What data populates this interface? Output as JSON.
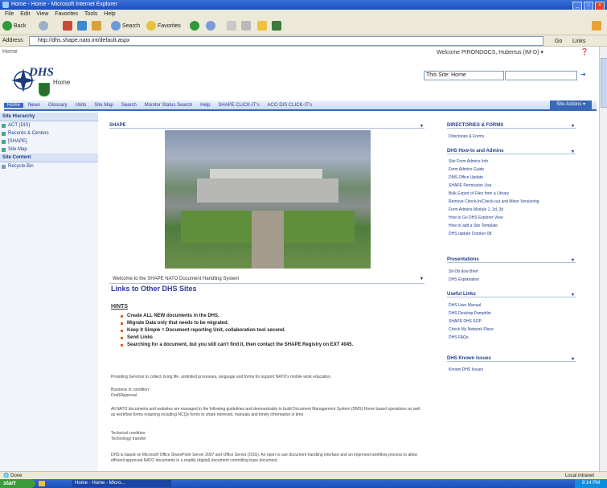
{
  "window": {
    "title": "Home - Home - Microsoft Internet Explorer"
  },
  "menu": [
    "File",
    "Edit",
    "View",
    "Favorites",
    "Tools",
    "Help"
  ],
  "toolbar": {
    "back": "Back",
    "search": "Search",
    "favorites": "Favorites"
  },
  "address": {
    "label": "Address",
    "url": "http://dhs.shape.nato.int/default.aspx",
    "go": "Go",
    "links": "Links"
  },
  "page": {
    "home_link": "Home",
    "welcome": "Welcome PIRONDOCS, Hubertus (IM-D) ▾",
    "logo_text": "DHS",
    "site_title": "Home",
    "search_scope": "This Site: Home",
    "top_nav": [
      "Home",
      "News",
      "Glossary",
      "Units",
      "Site Map",
      "Search",
      "Monitor Status Search",
      "Help",
      "SHAPE CLICK-IT's",
      "ACO DIS CLICK-IT's"
    ],
    "site_actions": "Site Actions ▾"
  },
  "quicklaunch": {
    "hierarchy_head": "Site Hierarchy",
    "items": [
      "ACT (DIS)",
      "Records & Centers",
      "[SHAPE]",
      "Site Map"
    ],
    "content_head": "Site Content",
    "recycle": "Recycle Bin"
  },
  "main": {
    "webpart_title": "SHAPE",
    "caption": "Welcome to the SHAPE NATO Document Handling System",
    "links_heading": "Links to Other DHS Sites",
    "hints_heading": "HINTS",
    "bullets": [
      "Create ALL NEW documents in the DHS.",
      "Migrate Data only that needs to be migrated.",
      "Keep It Simple = Document reporting Unit, collaboration tool second.",
      "Send Links",
      "Searching for a document, but you still can't find it, then contact the SHAPE Registry on EXT 4045."
    ],
    "para1": "Providing Services to collect, bring life, unlimited processes, language and forms for support NATO's mobile work education.",
    "para2_head": "Business in condition:",
    "para2": "Draft/Approval",
    "para3": "All NATO documents and websites are managed in the following guidelines and demonstrably to build Document Management System (DMS) Home based operations as well as workflow forms requiring including NCQs forms to share retrieved, manuals and timely information in time.",
    "para4_head": "Technical condition:",
    "para4": "Technology transfer",
    "para5": "DHS is based on Microsoft Office SharePoint Server 2007 and Office Server (OSS). An open to use document handling interface and an improved workflow process to allow efficient approved NATO documents in a readily (digital) document controlling base document."
  },
  "rightcol": {
    "sections": [
      {
        "head": "DIRECTORIES & FORMS",
        "links": [
          "Directories & Forms"
        ]
      },
      {
        "head": "DHS How-to and Admins",
        "links": [
          "Site Form Admins Info",
          "Form Admins Guide",
          "DMS Office Update",
          "SHAPE Permission Use",
          "Bulk Export of Files from a Library",
          "Remove Check-In/Check-out and Minor Versioning",
          "Form Admins Module 1, 2d, 3d",
          "How to Go DHS Explorer View",
          "How to add a Site Template",
          "DHS update October 08"
        ]
      },
      {
        "head": "Presentations",
        "links": [
          "Sit-Ob dow Brief",
          "DHS Explanation"
        ]
      },
      {
        "head": "Useful Links",
        "links": [
          "DHS User Manual",
          "DHS Desktop Pamphlet",
          "SHAPE DHS SOP",
          "Check My Network Place",
          "DHS FAQs"
        ]
      },
      {
        "head": "DHS Known Issues",
        "links": [
          "Known DHS Issues"
        ]
      }
    ]
  },
  "status": {
    "left": "Done",
    "right": "Local intranet"
  },
  "taskbar": {
    "start": "start",
    "task": "Home - Home - Micro...",
    "clock": "9:14 PM"
  }
}
